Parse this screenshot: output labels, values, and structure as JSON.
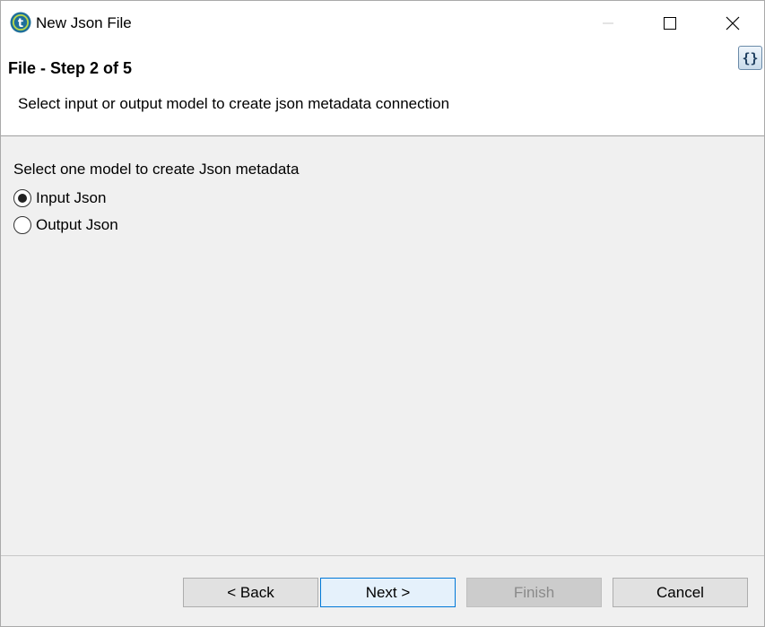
{
  "window": {
    "title": "New Json File",
    "app_icon": "talend-icon",
    "controls": {
      "minimize": "minimize-icon",
      "maximize": "maximize-icon",
      "close": "close-icon"
    }
  },
  "header": {
    "step_title": "File - Step 2 of 5",
    "description": "Select input or output model to create json metadata connection",
    "badge_text": "{}"
  },
  "content": {
    "group_label": "Select one model to create Json metadata",
    "options": [
      {
        "label": "Input Json",
        "selected": true
      },
      {
        "label": "Output Json",
        "selected": false
      }
    ]
  },
  "footer": {
    "back_label": "< Back",
    "next_label": "Next >",
    "finish_label": "Finish",
    "finish_enabled": false,
    "cancel_label": "Cancel"
  }
}
